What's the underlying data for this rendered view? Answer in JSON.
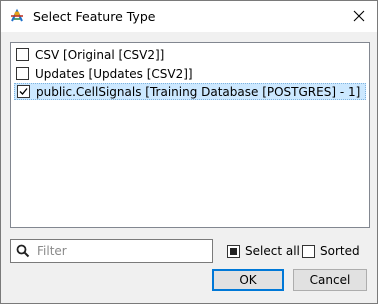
{
  "window": {
    "title": "Select Feature Type",
    "close_icon": "close-icon",
    "app_icon": "fme-workbench-icon"
  },
  "feature_list": {
    "items": [
      {
        "label": "CSV [Original [CSV2]]",
        "checked": false,
        "selected": false
      },
      {
        "label": "Updates [Updates [CSV2]]",
        "checked": false,
        "selected": false
      },
      {
        "label": "public.CellSignals [Training Database [POSTGRES] - 1]",
        "checked": true,
        "selected": true
      }
    ]
  },
  "filter": {
    "placeholder": "Filter",
    "value": "",
    "icon": "search-icon"
  },
  "select_all": {
    "label": "Select all",
    "checked": "partial"
  },
  "sorted": {
    "label": "Sorted",
    "checked": false
  },
  "buttons": {
    "ok": "OK",
    "cancel": "Cancel"
  }
}
